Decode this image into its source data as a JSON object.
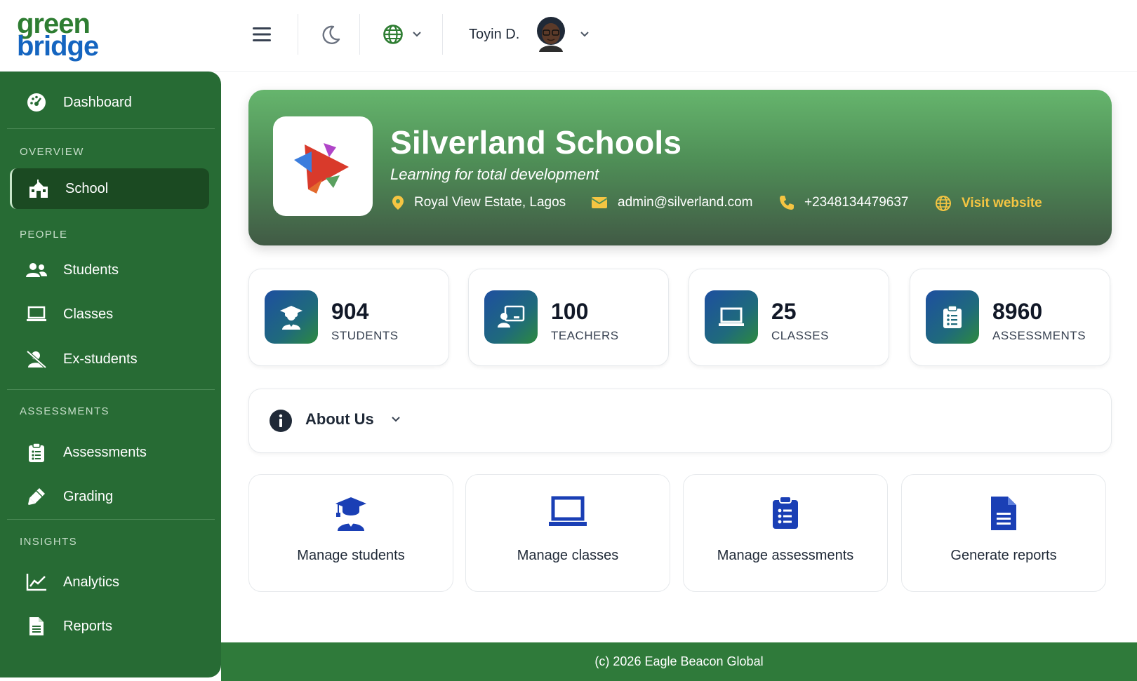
{
  "brand": {
    "line1": "green",
    "line2": "bridge",
    "green": "#2e7d32",
    "blue": "#1565c0"
  },
  "header": {
    "menu_icon": "hamburger-icon",
    "theme_icon": "moon-icon",
    "language_icon": "globe-icon",
    "user_name": "Toyin D."
  },
  "sidebar": {
    "dashboard": "Dashboard",
    "sections": {
      "overview": "OVERVIEW",
      "people": "PEOPLE",
      "assessments": "ASSESSMENTS",
      "insights": "INSIGHTS"
    },
    "items": {
      "school": "School",
      "students": "Students",
      "classes": "Classes",
      "ex_students": "Ex-students",
      "assessments": "Assessments",
      "grading": "Grading",
      "analytics": "Analytics",
      "reports": "Reports"
    },
    "active": "School",
    "bg_color": "#276b34"
  },
  "school": {
    "name": "Silverland Schools",
    "tagline": "Learning for total development",
    "address": "Royal View Estate, Lagos",
    "email": "admin@silverland.com",
    "phone": "+2348134479637",
    "website_label": "Visit website"
  },
  "stats": [
    {
      "value": "904",
      "label": "STUDENTS",
      "icon": "graduate-icon"
    },
    {
      "value": "100",
      "label": "TEACHERS",
      "icon": "teacher-icon"
    },
    {
      "value": "25",
      "label": "CLASSES",
      "icon": "laptop-icon"
    },
    {
      "value": "8960",
      "label": "ASSESSMENTS",
      "icon": "clipboard-icon"
    }
  ],
  "about": {
    "label": "About Us"
  },
  "actions": [
    {
      "label": "Manage students",
      "icon": "graduate-icon"
    },
    {
      "label": "Manage classes",
      "icon": "laptop-icon"
    },
    {
      "label": "Manage assessments",
      "icon": "clipboard-icon"
    },
    {
      "label": "Generate reports",
      "icon": "document-icon"
    }
  ],
  "footer": {
    "text": "(c) 2026 Eagle Beacon Global"
  }
}
